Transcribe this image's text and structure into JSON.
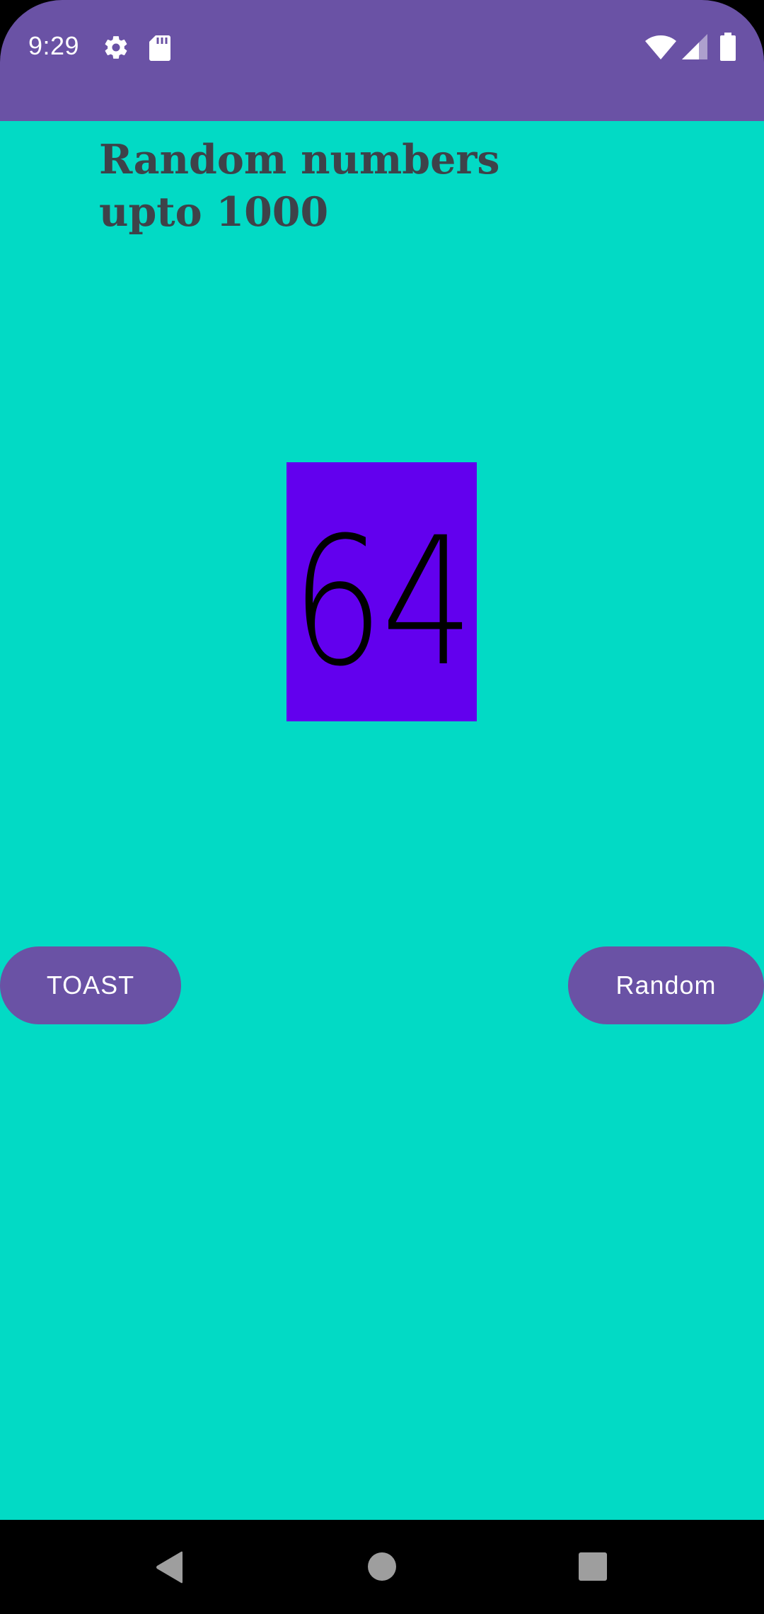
{
  "status_bar": {
    "time": "9:29",
    "icons": [
      "gear-icon",
      "sd-card-icon",
      "wifi-icon",
      "signal-icon",
      "battery-icon"
    ],
    "background": "#6a52a5"
  },
  "app": {
    "title": "Random numbers upto 1000",
    "number": "64",
    "background": "#02dac5",
    "number_box_color": "#6200ee"
  },
  "buttons": {
    "toast_label": "TOAST",
    "random_label": "Random",
    "color": "#6a52a5"
  },
  "nav_bar": {
    "icons": [
      "back-icon",
      "home-icon",
      "recents-icon"
    ]
  }
}
